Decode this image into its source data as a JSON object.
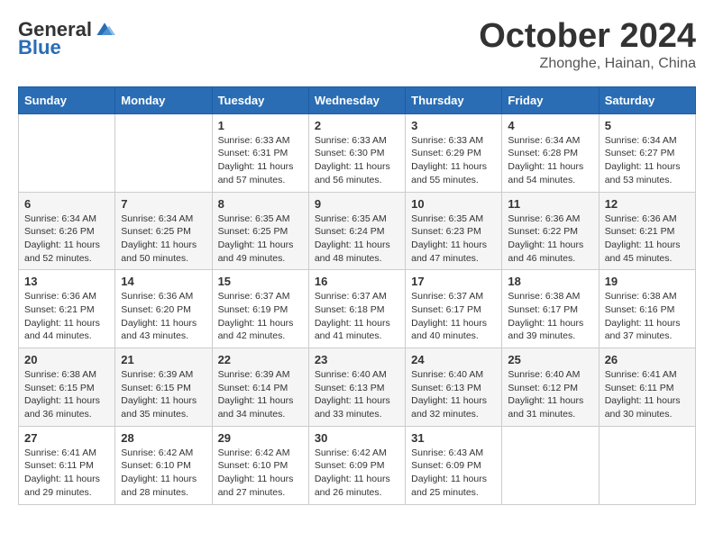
{
  "header": {
    "logo_general": "General",
    "logo_blue": "Blue",
    "title": "October 2024",
    "location": "Zhonghe, Hainan, China"
  },
  "days_of_week": [
    "Sunday",
    "Monday",
    "Tuesday",
    "Wednesday",
    "Thursday",
    "Friday",
    "Saturday"
  ],
  "weeks": [
    [
      {
        "day": "",
        "info": ""
      },
      {
        "day": "",
        "info": ""
      },
      {
        "day": "1",
        "info": "Sunrise: 6:33 AM\nSunset: 6:31 PM\nDaylight: 11 hours and 57 minutes."
      },
      {
        "day": "2",
        "info": "Sunrise: 6:33 AM\nSunset: 6:30 PM\nDaylight: 11 hours and 56 minutes."
      },
      {
        "day": "3",
        "info": "Sunrise: 6:33 AM\nSunset: 6:29 PM\nDaylight: 11 hours and 55 minutes."
      },
      {
        "day": "4",
        "info": "Sunrise: 6:34 AM\nSunset: 6:28 PM\nDaylight: 11 hours and 54 minutes."
      },
      {
        "day": "5",
        "info": "Sunrise: 6:34 AM\nSunset: 6:27 PM\nDaylight: 11 hours and 53 minutes."
      }
    ],
    [
      {
        "day": "6",
        "info": "Sunrise: 6:34 AM\nSunset: 6:26 PM\nDaylight: 11 hours and 52 minutes."
      },
      {
        "day": "7",
        "info": "Sunrise: 6:34 AM\nSunset: 6:25 PM\nDaylight: 11 hours and 50 minutes."
      },
      {
        "day": "8",
        "info": "Sunrise: 6:35 AM\nSunset: 6:25 PM\nDaylight: 11 hours and 49 minutes."
      },
      {
        "day": "9",
        "info": "Sunrise: 6:35 AM\nSunset: 6:24 PM\nDaylight: 11 hours and 48 minutes."
      },
      {
        "day": "10",
        "info": "Sunrise: 6:35 AM\nSunset: 6:23 PM\nDaylight: 11 hours and 47 minutes."
      },
      {
        "day": "11",
        "info": "Sunrise: 6:36 AM\nSunset: 6:22 PM\nDaylight: 11 hours and 46 minutes."
      },
      {
        "day": "12",
        "info": "Sunrise: 6:36 AM\nSunset: 6:21 PM\nDaylight: 11 hours and 45 minutes."
      }
    ],
    [
      {
        "day": "13",
        "info": "Sunrise: 6:36 AM\nSunset: 6:21 PM\nDaylight: 11 hours and 44 minutes."
      },
      {
        "day": "14",
        "info": "Sunrise: 6:36 AM\nSunset: 6:20 PM\nDaylight: 11 hours and 43 minutes."
      },
      {
        "day": "15",
        "info": "Sunrise: 6:37 AM\nSunset: 6:19 PM\nDaylight: 11 hours and 42 minutes."
      },
      {
        "day": "16",
        "info": "Sunrise: 6:37 AM\nSunset: 6:18 PM\nDaylight: 11 hours and 41 minutes."
      },
      {
        "day": "17",
        "info": "Sunrise: 6:37 AM\nSunset: 6:17 PM\nDaylight: 11 hours and 40 minutes."
      },
      {
        "day": "18",
        "info": "Sunrise: 6:38 AM\nSunset: 6:17 PM\nDaylight: 11 hours and 39 minutes."
      },
      {
        "day": "19",
        "info": "Sunrise: 6:38 AM\nSunset: 6:16 PM\nDaylight: 11 hours and 37 minutes."
      }
    ],
    [
      {
        "day": "20",
        "info": "Sunrise: 6:38 AM\nSunset: 6:15 PM\nDaylight: 11 hours and 36 minutes."
      },
      {
        "day": "21",
        "info": "Sunrise: 6:39 AM\nSunset: 6:15 PM\nDaylight: 11 hours and 35 minutes."
      },
      {
        "day": "22",
        "info": "Sunrise: 6:39 AM\nSunset: 6:14 PM\nDaylight: 11 hours and 34 minutes."
      },
      {
        "day": "23",
        "info": "Sunrise: 6:40 AM\nSunset: 6:13 PM\nDaylight: 11 hours and 33 minutes."
      },
      {
        "day": "24",
        "info": "Sunrise: 6:40 AM\nSunset: 6:13 PM\nDaylight: 11 hours and 32 minutes."
      },
      {
        "day": "25",
        "info": "Sunrise: 6:40 AM\nSunset: 6:12 PM\nDaylight: 11 hours and 31 minutes."
      },
      {
        "day": "26",
        "info": "Sunrise: 6:41 AM\nSunset: 6:11 PM\nDaylight: 11 hours and 30 minutes."
      }
    ],
    [
      {
        "day": "27",
        "info": "Sunrise: 6:41 AM\nSunset: 6:11 PM\nDaylight: 11 hours and 29 minutes."
      },
      {
        "day": "28",
        "info": "Sunrise: 6:42 AM\nSunset: 6:10 PM\nDaylight: 11 hours and 28 minutes."
      },
      {
        "day": "29",
        "info": "Sunrise: 6:42 AM\nSunset: 6:10 PM\nDaylight: 11 hours and 27 minutes."
      },
      {
        "day": "30",
        "info": "Sunrise: 6:42 AM\nSunset: 6:09 PM\nDaylight: 11 hours and 26 minutes."
      },
      {
        "day": "31",
        "info": "Sunrise: 6:43 AM\nSunset: 6:09 PM\nDaylight: 11 hours and 25 minutes."
      },
      {
        "day": "",
        "info": ""
      },
      {
        "day": "",
        "info": ""
      }
    ]
  ]
}
